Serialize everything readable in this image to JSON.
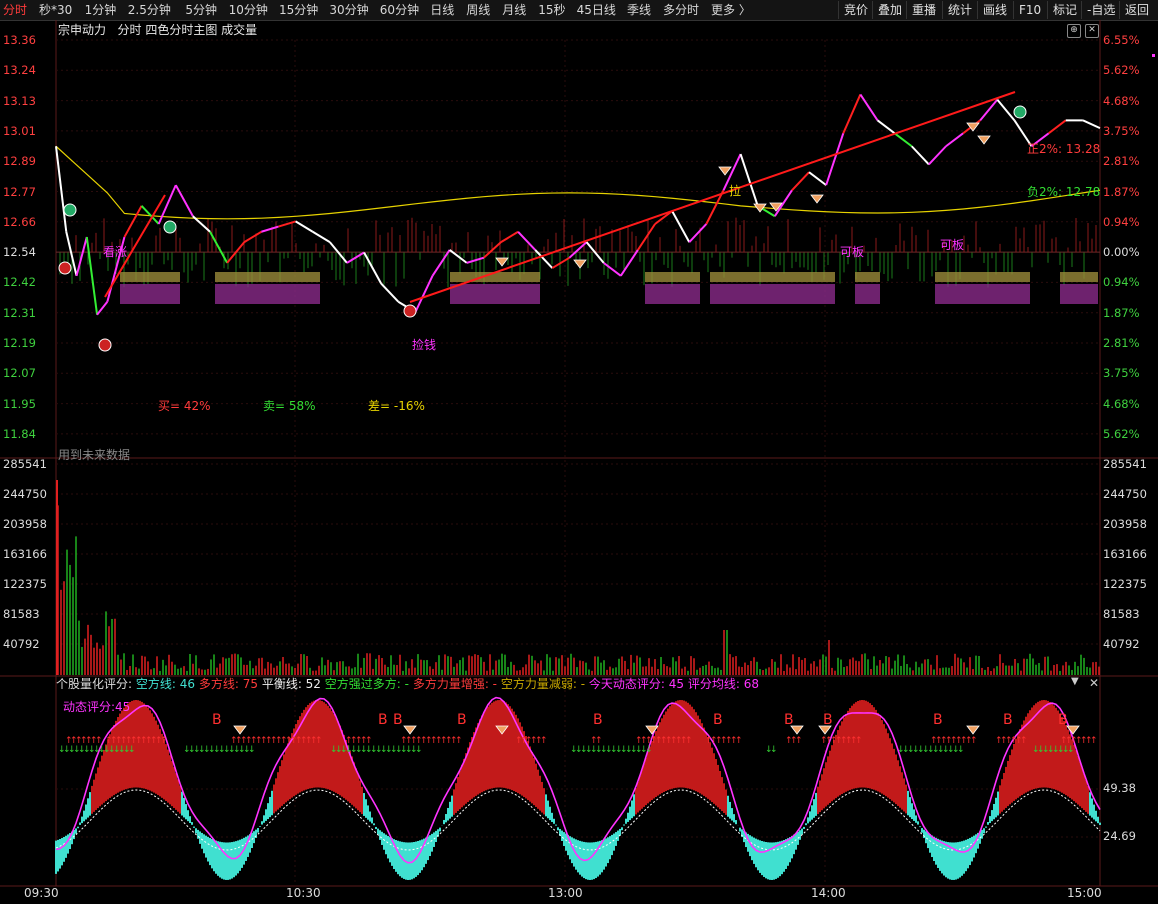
{
  "toolbar": {
    "periods": [
      {
        "label": "分时",
        "active": true
      },
      {
        "label": "秒*30"
      },
      {
        "label": "1分钟"
      },
      {
        "label": "2.5分钟"
      },
      {
        "label": "5分钟"
      },
      {
        "label": "10分钟"
      },
      {
        "label": "15分钟"
      },
      {
        "label": "30分钟"
      },
      {
        "label": "60分钟"
      },
      {
        "label": "日线"
      },
      {
        "label": "周线"
      },
      {
        "label": "月线"
      },
      {
        "label": "15秒"
      },
      {
        "label": "45日线"
      },
      {
        "label": "季线"
      },
      {
        "label": "多分时"
      },
      {
        "label": "更多 〉"
      }
    ],
    "right_buttons": [
      "竞价",
      "叠加",
      "重播",
      "统计",
      "画线",
      "F10",
      "标记",
      "-自选",
      "返回"
    ]
  },
  "header": {
    "title": "宗申动力",
    "mode": "分时",
    "indicator": "四色分时主图",
    "volume_label": "成交量",
    "plus_icon": "⊕",
    "close_icon": "✕"
  },
  "price_axis": {
    "left": [
      {
        "v": "13.36",
        "c": "up"
      },
      {
        "v": "13.24",
        "c": "up"
      },
      {
        "v": "13.13",
        "c": "up"
      },
      {
        "v": "13.01",
        "c": "up"
      },
      {
        "v": "12.89",
        "c": "up"
      },
      {
        "v": "12.77",
        "c": "up"
      },
      {
        "v": "12.66",
        "c": "up"
      },
      {
        "v": "12.54",
        "c": "flat"
      },
      {
        "v": "12.42",
        "c": "down"
      },
      {
        "v": "12.31",
        "c": "down"
      },
      {
        "v": "12.19",
        "c": "down"
      },
      {
        "v": "12.07",
        "c": "down"
      },
      {
        "v": "11.95",
        "c": "down"
      },
      {
        "v": "11.84",
        "c": "down"
      }
    ],
    "right": [
      {
        "v": "6.55%",
        "c": "up"
      },
      {
        "v": "5.62%",
        "c": "up"
      },
      {
        "v": "4.68%",
        "c": "up"
      },
      {
        "v": "3.75%",
        "c": "up"
      },
      {
        "v": "2.81%",
        "c": "up"
      },
      {
        "v": "1.87%",
        "c": "up"
      },
      {
        "v": "0.94%",
        "c": "up"
      },
      {
        "v": "0.00%",
        "c": "flat"
      },
      {
        "v": "0.94%",
        "c": "down"
      },
      {
        "v": "1.87%",
        "c": "down"
      },
      {
        "v": "2.81%",
        "c": "down"
      },
      {
        "v": "3.75%",
        "c": "down"
      },
      {
        "v": "4.68%",
        "c": "down"
      },
      {
        "v": "5.62%",
        "c": "down"
      }
    ]
  },
  "annotations": {
    "buy": "买= 42%",
    "sell": "卖= 58%",
    "diff": "差= -16%",
    "future_data": "用到未来数据",
    "positive": "正2%: 13.28",
    "negative": "负2%: 12.78",
    "grab_money": "捡钱",
    "pull_up": "拉",
    "can_board_1": "可板",
    "can_board_2": "可板",
    "watch_up": "看涨"
  },
  "volume_axis": [
    "285541",
    "244750",
    "203958",
    "163166",
    "122375",
    "81583",
    "40792"
  ],
  "indicator": {
    "name": "个股量化评分:",
    "empty_line": "空方线: 46",
    "long_line": "多方线: 75",
    "balance_line": "平衡线: 52",
    "empty_over_long": "空方强过多方: -",
    "long_strengthen": "多方力量增强: -",
    "empty_weaken": "空方力量减弱: -",
    "today_score": "今天动态评分: 45",
    "avg_score": "评分均线: 68",
    "dyn_label": "动态评分:45",
    "axis": [
      "49.38",
      "24.69"
    ]
  },
  "time_axis": [
    "09:30",
    "10:30",
    "13:00",
    "14:00",
    "15:00"
  ],
  "colors": {
    "up": "#ff3b3b",
    "down": "#33cc33",
    "avg_line": "#e6d200",
    "magenta": "#ff33ff",
    "cyan": "#40e0d0",
    "dark_red": "#c21a1a",
    "trend": "#ff1a1a"
  },
  "chart_data": {
    "type": "line",
    "title": "宗申动力 分时",
    "x": [
      "09:30",
      "10:30",
      "13:00",
      "14:00",
      "15:00"
    ],
    "price_series": [
      {
        "t": 0,
        "p": 12.95
      },
      {
        "t": 3,
        "p": 12.62
      },
      {
        "t": 6,
        "p": 12.45
      },
      {
        "t": 9,
        "p": 12.6
      },
      {
        "t": 12,
        "p": 12.3
      },
      {
        "t": 15,
        "p": 12.35
      },
      {
        "t": 20,
        "p": 12.6
      },
      {
        "t": 25,
        "p": 12.72
      },
      {
        "t": 30,
        "p": 12.65
      },
      {
        "t": 35,
        "p": 12.8
      },
      {
        "t": 40,
        "p": 12.68
      },
      {
        "t": 45,
        "p": 12.62
      },
      {
        "t": 50,
        "p": 12.5
      },
      {
        "t": 55,
        "p": 12.58
      },
      {
        "t": 60,
        "p": 12.62
      },
      {
        "t": 65,
        "p": 12.64
      },
      {
        "t": 70,
        "p": 12.66
      },
      {
        "t": 75,
        "p": 12.62
      },
      {
        "t": 80,
        "p": 12.58
      },
      {
        "t": 85,
        "p": 12.5
      },
      {
        "t": 90,
        "p": 12.54
      },
      {
        "t": 95,
        "p": 12.42
      },
      {
        "t": 100,
        "p": 12.35
      },
      {
        "t": 105,
        "p": 12.31
      },
      {
        "t": 110,
        "p": 12.45
      },
      {
        "t": 115,
        "p": 12.55
      },
      {
        "t": 120,
        "p": 12.5
      },
      {
        "t": 125,
        "p": 12.52
      },
      {
        "t": 130,
        "p": 12.58
      },
      {
        "t": 135,
        "p": 12.62
      },
      {
        "t": 140,
        "p": 12.55
      },
      {
        "t": 145,
        "p": 12.48
      },
      {
        "t": 150,
        "p": 12.52
      },
      {
        "t": 155,
        "p": 12.58
      },
      {
        "t": 160,
        "p": 12.5
      },
      {
        "t": 165,
        "p": 12.45
      },
      {
        "t": 170,
        "p": 12.55
      },
      {
        "t": 175,
        "p": 12.65
      },
      {
        "t": 180,
        "p": 12.7
      },
      {
        "t": 185,
        "p": 12.58
      },
      {
        "t": 190,
        "p": 12.65
      },
      {
        "t": 195,
        "p": 12.78
      },
      {
        "t": 200,
        "p": 12.92
      },
      {
        "t": 205,
        "p": 12.72
      },
      {
        "t": 210,
        "p": 12.68
      },
      {
        "t": 215,
        "p": 12.78
      },
      {
        "t": 220,
        "p": 12.85
      },
      {
        "t": 225,
        "p": 12.8
      },
      {
        "t": 230,
        "p": 13.0
      },
      {
        "t": 235,
        "p": 13.15
      },
      {
        "t": 240,
        "p": 13.05
      },
      {
        "t": 245,
        "p": 13.0
      },
      {
        "t": 250,
        "p": 12.95
      },
      {
        "t": 255,
        "p": 12.88
      },
      {
        "t": 260,
        "p": 12.95
      },
      {
        "t": 265,
        "p": 13.0
      },
      {
        "t": 270,
        "p": 13.05
      },
      {
        "t": 275,
        "p": 13.13
      },
      {
        "t": 280,
        "p": 13.05
      },
      {
        "t": 285,
        "p": 12.95
      },
      {
        "t": 290,
        "p": 13.0
      },
      {
        "t": 295,
        "p": 13.05
      },
      {
        "t": 300,
        "p": 13.05
      },
      {
        "t": 305,
        "p": 13.02
      }
    ],
    "avg_price": 12.7,
    "prev_close": 12.54,
    "ylim": [
      11.84,
      13.36
    ],
    "volume_max": 285541
  }
}
